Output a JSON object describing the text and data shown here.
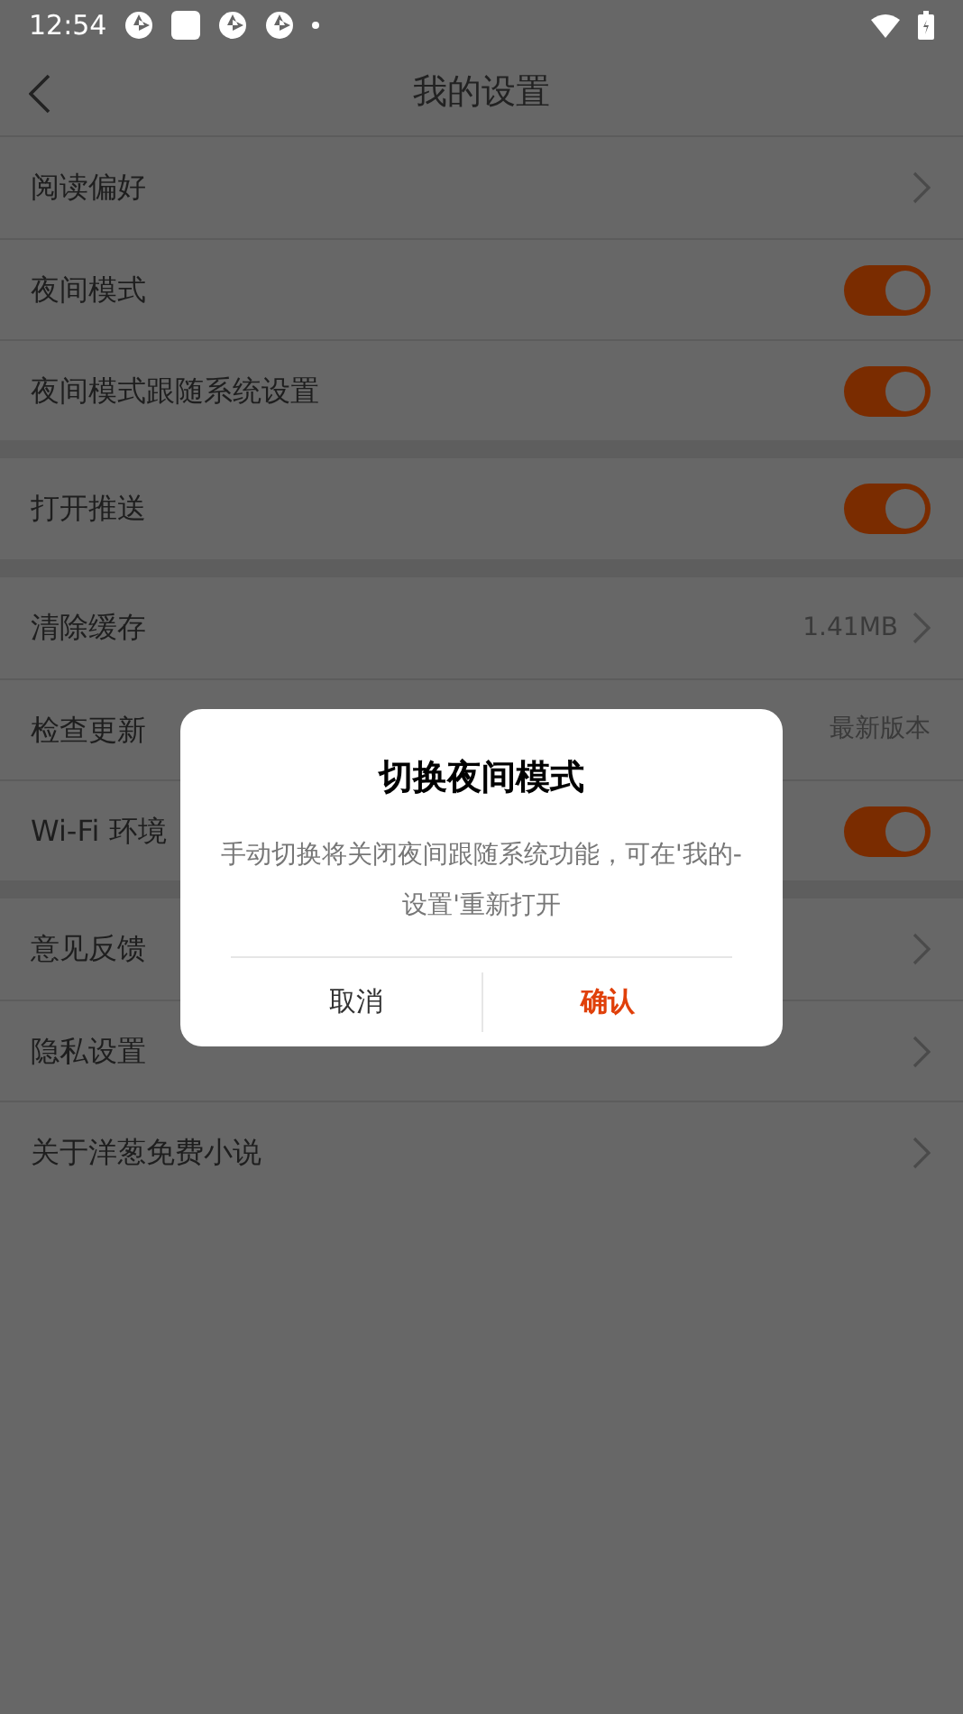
{
  "status_bar": {
    "time": "12:54"
  },
  "header": {
    "title": "我的设置"
  },
  "sections": [
    {
      "rows": [
        {
          "label": "阅读偏好",
          "kind": "link"
        },
        {
          "label": "夜间模式",
          "kind": "switch",
          "on": true
        },
        {
          "label": "夜间模式跟随系统设置",
          "kind": "switch",
          "on": true
        }
      ]
    },
    {
      "rows": [
        {
          "label": "打开推送",
          "kind": "switch",
          "on": true
        }
      ]
    },
    {
      "rows": [
        {
          "label": "清除缓存",
          "kind": "link",
          "value": "1.41MB"
        },
        {
          "label": "检查更新",
          "kind": "info",
          "value": "最新版本"
        },
        {
          "label": "Wi-Fi 环境",
          "kind": "switch",
          "on": true
        }
      ]
    },
    {
      "rows": [
        {
          "label": "意见反馈",
          "kind": "link"
        },
        {
          "label": "隐私设置",
          "kind": "link"
        },
        {
          "label": "关于洋葱免费小说",
          "kind": "link"
        }
      ]
    }
  ],
  "dialog": {
    "title": "切换夜间模式",
    "message": "手动切换将关闭夜间跟随系统功能，可在'我的-设置'重新打开",
    "buttons": [
      {
        "label": "取消",
        "kind": "cancel"
      },
      {
        "label": "确认",
        "kind": "confirm"
      }
    ]
  }
}
